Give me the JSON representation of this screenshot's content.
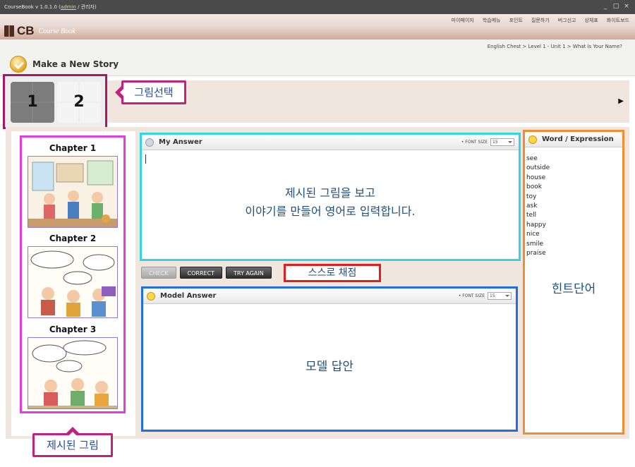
{
  "window": {
    "title_prefix": "CourseBook v 1.0.1.0 (",
    "user": "admin",
    "title_mid": " / ",
    "user2": "관리자",
    "title_suffix": ")",
    "controls": [
      "_",
      "□",
      "×"
    ]
  },
  "app": {
    "logo_main": "CB",
    "logo_sub": "Course Book"
  },
  "topnav": {
    "items": [
      "마이페이지",
      "학습메뉴",
      "포인트",
      "질문하기",
      "버그신고",
      "상체표",
      "화이트보드"
    ]
  },
  "breadcrumb": "English Chest > Level 1 - Unit 1 > What Is Your Name?",
  "page": {
    "title": "Make a New Story"
  },
  "picture_select": {
    "tiles": [
      "1",
      "2"
    ],
    "callout": "그림선택",
    "arrow": "▶"
  },
  "chapters": {
    "items": [
      {
        "label": "Chapter 1"
      },
      {
        "label": "Chapter 2"
      },
      {
        "label": "Chapter 3"
      }
    ],
    "callout": "제시된 그림"
  },
  "my_answer": {
    "title": "My Answer",
    "font_size_label": "• FONT SIZE",
    "font_size_value": "15",
    "annotation_line1": "제시된 그림을 보고",
    "annotation_line2": "이야기를 만들어 영어로 입력합니다."
  },
  "buttons": {
    "check": "CHECK",
    "correct": "CORRECT",
    "try_again": "TRY AGAIN",
    "callout": "스스로 채점"
  },
  "model_answer": {
    "title": "Model Answer",
    "font_size_label": "• FONT SIZE",
    "font_size_value": "15",
    "annotation": "모델 답안"
  },
  "words": {
    "title": "Word / Expression",
    "list": [
      "see",
      "outside",
      "house",
      "book",
      "toy",
      "ask",
      "tell",
      "happy",
      "nice",
      "smile",
      "praise"
    ],
    "annotation": "힌트단어"
  },
  "colors": {
    "picture_select_border": "#a41a66",
    "callout_border": "#c2227f",
    "chapters_border": "#e43ddc",
    "my_answer_border": "#35d4e4",
    "model_answer_border": "#1f6fe0",
    "self_grade_border": "#e02020",
    "words_border": "#f08e35",
    "annotation_text": "#1f4f7c"
  }
}
